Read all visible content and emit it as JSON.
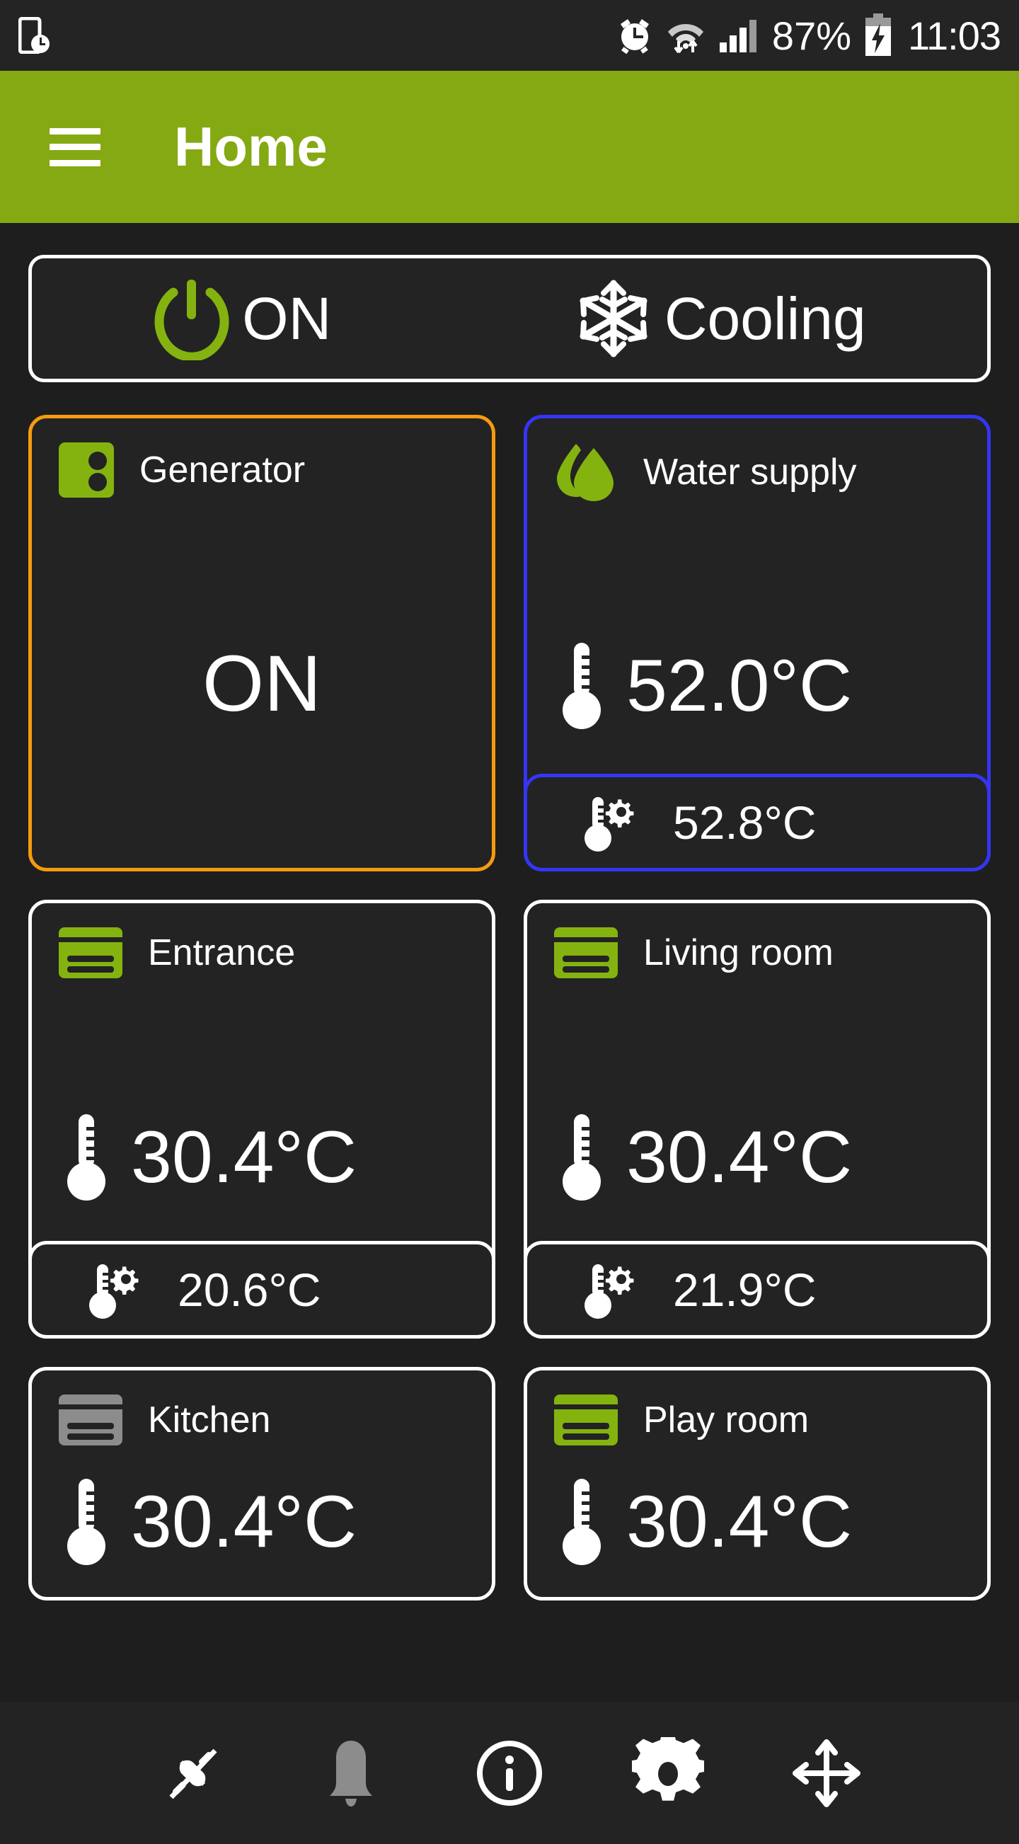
{
  "statusbar": {
    "left_icons": [
      {
        "name": "phone-clock-icon",
        "glyph": "phone-clock"
      }
    ],
    "right_icons": [
      {
        "name": "alarm-clock-icon",
        "glyph": "alarm"
      },
      {
        "name": "wifi-transfer-icon",
        "glyph": "wifi"
      },
      {
        "name": "cellular-signal-icon",
        "glyph": "signal"
      }
    ],
    "battery_percent": "87%",
    "battery_icon": "battery-charging-icon",
    "time": "11:03"
  },
  "appbar": {
    "menu_icon": "hamburger-menu-icon",
    "title": "Home",
    "bg_color": "#84a913"
  },
  "status_pill": {
    "power": {
      "icon": "power-icon",
      "label": "ON",
      "icon_color": "#84b310"
    },
    "mode": {
      "icon": "snowflake-icon",
      "label": "Cooling",
      "icon_color": "#ffffff"
    }
  },
  "colors": {
    "accent_green": "#84b310",
    "accent_orange": "#f59b0f",
    "accent_blue": "#3535f5",
    "card_bg": "#232323",
    "page_bg": "#1e1e1e",
    "inactive_gray": "#8c8c8c"
  },
  "cards": [
    {
      "id": "generator",
      "title": "Generator",
      "icon": "generator-socket-icon",
      "icon_color": "#84b310",
      "border_color": "#f59b0f",
      "value": "ON",
      "has_setpoint": false
    },
    {
      "id": "water-supply",
      "title": "Water supply",
      "icon": "water-drops-icon",
      "icon_color": "#84b310",
      "border_color": "#3535f5",
      "value": "52.0°C",
      "has_setpoint": true,
      "setpoint_icon": "thermometer-gear-icon",
      "setpoint_value": "52.8°C"
    },
    {
      "id": "entrance",
      "title": "Entrance",
      "icon": "radiator-icon",
      "icon_color": "#84b310",
      "border_color": "#ffffff",
      "value": "30.4°C",
      "has_setpoint": true,
      "setpoint_icon": "thermometer-gear-icon",
      "setpoint_value": "20.6°C"
    },
    {
      "id": "living-room",
      "title": "Living room",
      "icon": "radiator-icon",
      "icon_color": "#84b310",
      "border_color": "#ffffff",
      "value": "30.4°C",
      "has_setpoint": true,
      "setpoint_icon": "thermometer-gear-icon",
      "setpoint_value": "21.9°C"
    },
    {
      "id": "kitchen",
      "title": "Kitchen",
      "icon": "radiator-icon",
      "icon_color": "#8c8c8c",
      "border_color": "#ffffff",
      "value": "30.4°C",
      "has_setpoint": false
    },
    {
      "id": "play-room",
      "title": "Play room",
      "icon": "radiator-icon",
      "icon_color": "#84b310",
      "border_color": "#ffffff",
      "value": "30.4°C",
      "has_setpoint": false
    }
  ],
  "bottomnav": {
    "items": [
      {
        "name": "disconnected-plug-icon",
        "active": true
      },
      {
        "name": "bell-icon",
        "active": false
      },
      {
        "name": "info-circle-icon",
        "active": true
      },
      {
        "name": "gear-icon",
        "active": true
      },
      {
        "name": "move-arrows-icon",
        "active": true
      }
    ]
  }
}
